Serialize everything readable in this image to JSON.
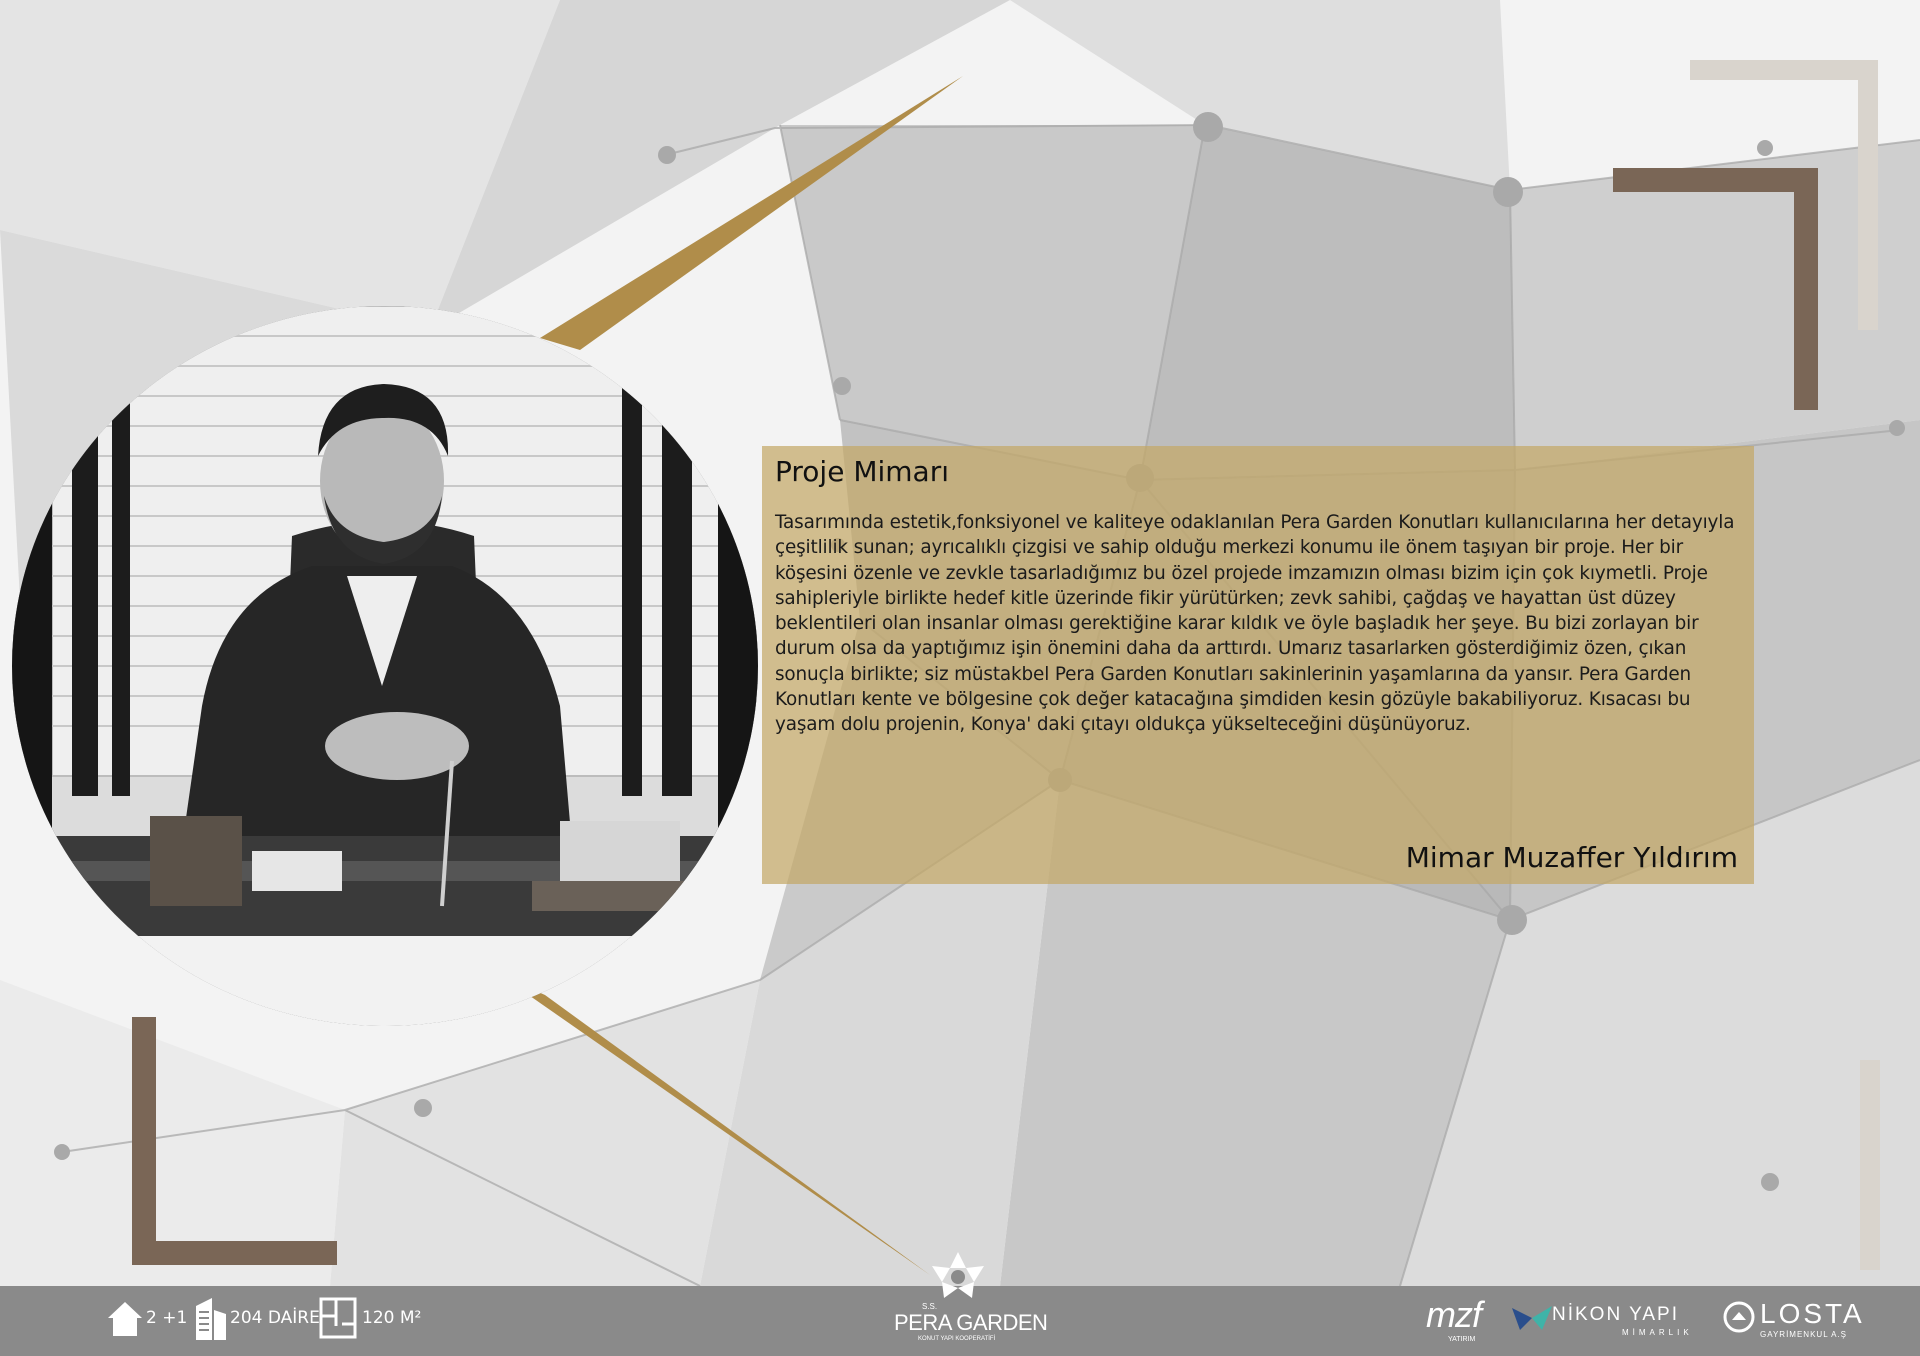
{
  "card": {
    "title": "Proje Mimarı",
    "body": "Tasarımında estetik,fonksiyonel ve kaliteye odaklanılan Pera Garden Konutları kullanıcılarına her detayıyla çeşitlilik sunan; ayrıcalıklı çizgisi ve sahip olduğu merkezi konumu ile önem taşıyan bir proje. Her bir köşesini özenle ve zevkle tasarladığımız bu özel projede imzamızın olması bizim için çok kıymetli. Proje sahipleriyle birlikte hedef kitle üzerinde fikir yürütürken; zevk sahibi, çağdaş ve hayattan üst düzey beklentileri olan insanlar olması gerektiğine karar kıldık ve öyle başladık her şeye. Bu bizi zorlayan bir durum olsa da yaptığımız işin önemini daha da arttırdı. Umarız tasarlarken gösterdiğimiz özen, çıkan sonuçla birlikte; siz müstakbel Pera Garden Konutları sakinlerinin yaşamlarına da yansır. Pera Garden Konutları kente ve bölgesine çok değer katacağına şimdiden kesin gözüyle bakabiliyoruz. Kısacası bu yaşam dolu projenin, Konya' daki çıtayı oldukça yükselteceğini düşünüyoruz.",
    "signature": "Mimar Muzaffer Yıldırım"
  },
  "footer": {
    "rooms": "2 +1",
    "units": "204 DAİRE",
    "area": "120 M²",
    "logo_ss": "S.S.",
    "logo_name": "PERA GARDEN",
    "logo_sub": "KONUT YAPI KOOPERATİFİ",
    "partner1": "mzf",
    "partner1_sub": "YATIRIM",
    "partner2": "NİKON YAPI",
    "partner2_sub": "MİMARLIK",
    "partner3": "LOSTA",
    "partner3_sub": "GAYRİMENKUL A.Ş"
  },
  "icons": [
    "house-icon",
    "building-icon",
    "floor-plan-icon",
    "flower-logo-icon"
  ],
  "colors": {
    "gold": "#b08d4a",
    "brown": "#7a6656",
    "footer": "#8a8a8a",
    "box": "#c4a766"
  }
}
